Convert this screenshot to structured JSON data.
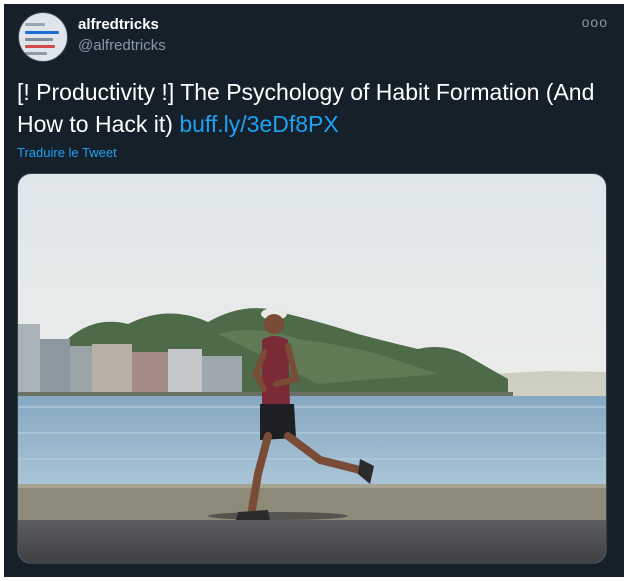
{
  "user": {
    "display_name": "alfredtricks",
    "handle": "@alfredtricks",
    "avatar_icon": "app-screenshot-avatar"
  },
  "menu": {
    "more_label": "ooo"
  },
  "tweet": {
    "text": "[! Productivity !] The Psychology of Habit Formation (And How to Hack it) ",
    "link_text": "buff.ly/3eDf8PX"
  },
  "translate_label": "Traduire le Tweet",
  "colors": {
    "background": "#15202b",
    "link": "#1da1f2",
    "secondary_text": "#8899a6"
  }
}
